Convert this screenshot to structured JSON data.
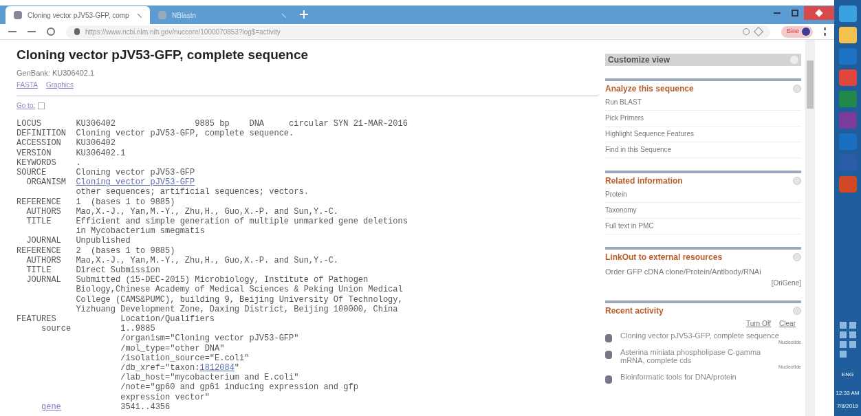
{
  "browser": {
    "tabs": [
      {
        "title": "Cloning vector pJV53-GFP, comp",
        "selected": true
      },
      {
        "title": "NBlastn",
        "selected": false
      }
    ],
    "address": "https://www.ncbi.nlm.nih.gov/nuccore/1000070853?log$=activity",
    "profile": "Bine"
  },
  "page": {
    "title": "Cloning vector pJV53-GFP, complete sequence",
    "subtitle": "GenBank: KU306402.1",
    "links": [
      "FASTA",
      "Graphics"
    ],
    "goto": "Go to:"
  },
  "record": [
    {
      "kind": "field",
      "key": "LOCUS",
      "lines": [
        "KU306402                9885 bp    DNA     circular SYN 21-MAR-2016"
      ]
    },
    {
      "kind": "field",
      "key": "DEFINITION",
      "lines": [
        "Cloning vector pJV53-GFP, complete sequence."
      ]
    },
    {
      "kind": "field",
      "key": "ACCESSION",
      "lines": [
        "KU306402"
      ]
    },
    {
      "kind": "field",
      "key": "VERSION",
      "lines": [
        "KU306402.1"
      ]
    },
    {
      "kind": "field",
      "key": "KEYWORDS",
      "lines": [
        "."
      ]
    },
    {
      "kind": "field",
      "key": "SOURCE",
      "lines": [
        "Cloning vector pJV53-GFP"
      ],
      "children": [
        {
          "key": "ORGANISM",
          "link": true,
          "lines": [
            "Cloning vector pJV53-GFP"
          ]
        },
        {
          "lines": [
            "other sequences; artificial sequences; vectors."
          ]
        }
      ]
    },
    {
      "kind": "field",
      "key": "REFERENCE",
      "lines": [
        "1  (bases 1 to 9885)"
      ],
      "children": [
        {
          "key": "AUTHORS",
          "lines": [
            "Mao,X.-J., Yan,M.-Y., Zhu,H., Guo,X.-P. and Sun,Y.-C."
          ]
        },
        {
          "key": "TITLE",
          "lines": [
            "Efficient and simple generation of multiple unmarked gene deletions",
            "in Mycobacterium smegmatis"
          ]
        },
        {
          "key": "JOURNAL",
          "lines": [
            "Unpublished"
          ]
        }
      ]
    },
    {
      "kind": "field",
      "key": "REFERENCE",
      "lines": [
        "2  (bases 1 to 9885)"
      ],
      "children": [
        {
          "key": "AUTHORS",
          "lines": [
            "Mao,X.-J., Yan,M.-Y., Zhu,H., Guo,X.-P. and Sun,Y.-C."
          ]
        },
        {
          "key": "TITLE",
          "lines": [
            "Direct Submission"
          ]
        },
        {
          "key": "JOURNAL",
          "lines": [
            "Submitted (15-DEC-2015) Microbiology, Institute of Pathogen",
            "Biology,Chinese Academy of Medical Sciences & Peking Union Medical",
            "College (CAMS&PUMC), building 9, Beijing University Of Technology,",
            "Yizhuang Development Zone, Daxing District, Beijing 100000, China"
          ]
        }
      ]
    },
    {
      "kind": "features",
      "key": "FEATURES",
      "lines": [
        "Location/Qualifiers"
      ],
      "children": [
        {
          "key": "source",
          "lines": [
            "1..9885",
            "/organism=\"Cloning vector pJV53-GFP\"",
            "/mol_type=\"other DNA\"",
            "/isolation_source=\"E.coli\"",
            {
              "parts": [
                {
                  "text": "/db_xref=\"taxon:"
                },
                {
                  "text": "1812084",
                  "link": true
                },
                {
                  "text": "\""
                }
              ]
            },
            "/lab_host=\"mycobacterium and E.coli\"",
            "/note=\"gp60 and gp61 inducing expression and gfp",
            "expression vector\""
          ]
        },
        {
          "key": "gene",
          "key_link": true,
          "lines": [
            "3541..4356"
          ]
        }
      ]
    }
  ],
  "sidebar": {
    "customize": "Customize view",
    "sections": [
      {
        "kind": "links",
        "title": "Analyze this sequence",
        "items": [
          "Run BLAST",
          "Pick Primers",
          "Highlight Sequence Features",
          "Find in this Sequence"
        ]
      },
      {
        "kind": "links",
        "title": "Related information",
        "items": [
          "Protein",
          "Taxonomy",
          "Full text in PMC"
        ]
      },
      {
        "kind": "linkout",
        "title": "LinkOut to external resources",
        "text": "Order GFP cDNA clone/Protein/Antibody/RNAi",
        "source": "[OriGene]"
      },
      {
        "kind": "activity",
        "title": "Recent activity",
        "actions": [
          "Turn Off",
          "Clear"
        ],
        "items": [
          {
            "text": "Cloning vector pJV53-GFP, complete sequence",
            "db": "Nucleotide"
          },
          {
            "text": "Asterina miniata phospholipase C-gamma mRNA, complete cds",
            "db": "Nucleotide"
          },
          {
            "text": "Bioinformatic tools for DNA/protein"
          }
        ]
      }
    ]
  },
  "taskbar": {
    "language": "ENG",
    "time": "12:33 AM",
    "date": "7/8/2019"
  }
}
